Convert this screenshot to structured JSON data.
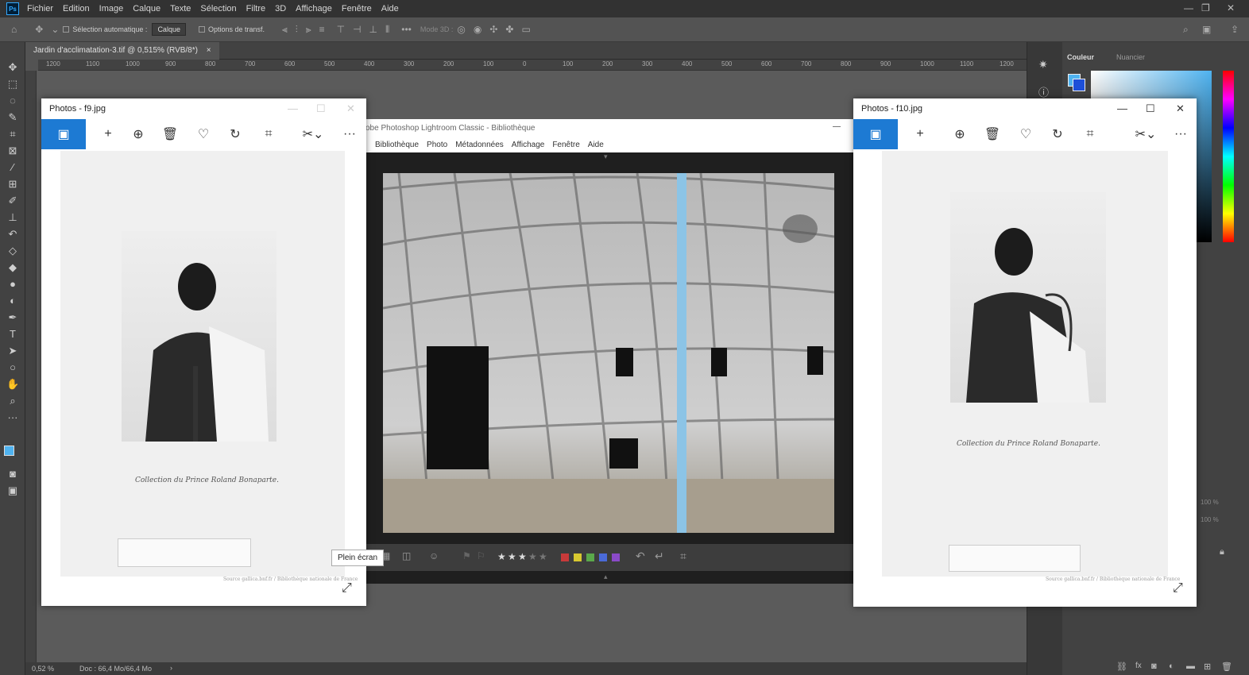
{
  "menubar": {
    "logo": "Ps",
    "items": [
      "Fichier",
      "Edition",
      "Image",
      "Calque",
      "Texte",
      "Sélection",
      "Filtre",
      "3D",
      "Affichage",
      "Fenêtre",
      "Aide"
    ]
  },
  "options": {
    "auto_select_label": "Sélection automatique :",
    "layer_select": "Calque",
    "transform_label": "Options de transf.",
    "mode3d": "Mode 3D :"
  },
  "document": {
    "tab_title": "Jardin d'acclimatation-3.tif @ 0,515% (RVB/8*)",
    "zoom": "0,52 %",
    "doc_info": "Doc : 66,4 Mo/66,4 Mo"
  },
  "ruler_ticks": [
    "1200",
    "1100",
    "1000",
    "900",
    "800",
    "700",
    "600",
    "500",
    "400",
    "300",
    "200",
    "100",
    "0",
    "100",
    "200",
    "300",
    "400",
    "500",
    "600",
    "700",
    "800",
    "900",
    "1000",
    "1100",
    "1200"
  ],
  "right_panel": {
    "tab_color": "Couleur",
    "tab_swatches": "Nuancier",
    "opacity_a": "100 %",
    "opacity_b": "100 %"
  },
  "photos_left": {
    "title": "Photos - f9.jpg",
    "caption": "Collection du Prince Roland Bonaparte.",
    "source": "Source gallica.bnf.fr / Bibliothèque nationale de France"
  },
  "photos_right": {
    "title": "Photos - f10.jpg",
    "caption": "Collection du Prince Roland Bonaparte.",
    "source": "Source gallica.bnf.fr / Bibliothèque nationale de France"
  },
  "lightroom": {
    "title": "obe Photoshop Lightroom Classic - Bibliothèque",
    "menu": [
      "Bibliothèque",
      "Photo",
      "Métadonnées",
      "Affichage",
      "Fenêtre",
      "Aide"
    ],
    "rating_filled": 3,
    "rating_total": 5,
    "color_labels": [
      "#c83a3a",
      "#d8c830",
      "#5aa84a",
      "#4a6ad8",
      "#8a4ac8"
    ]
  },
  "tooltip": "Plein écran",
  "colors": {
    "accent": "#1d7ad3",
    "foreground": "#4fb3f0",
    "background": "#1d4fd8"
  }
}
